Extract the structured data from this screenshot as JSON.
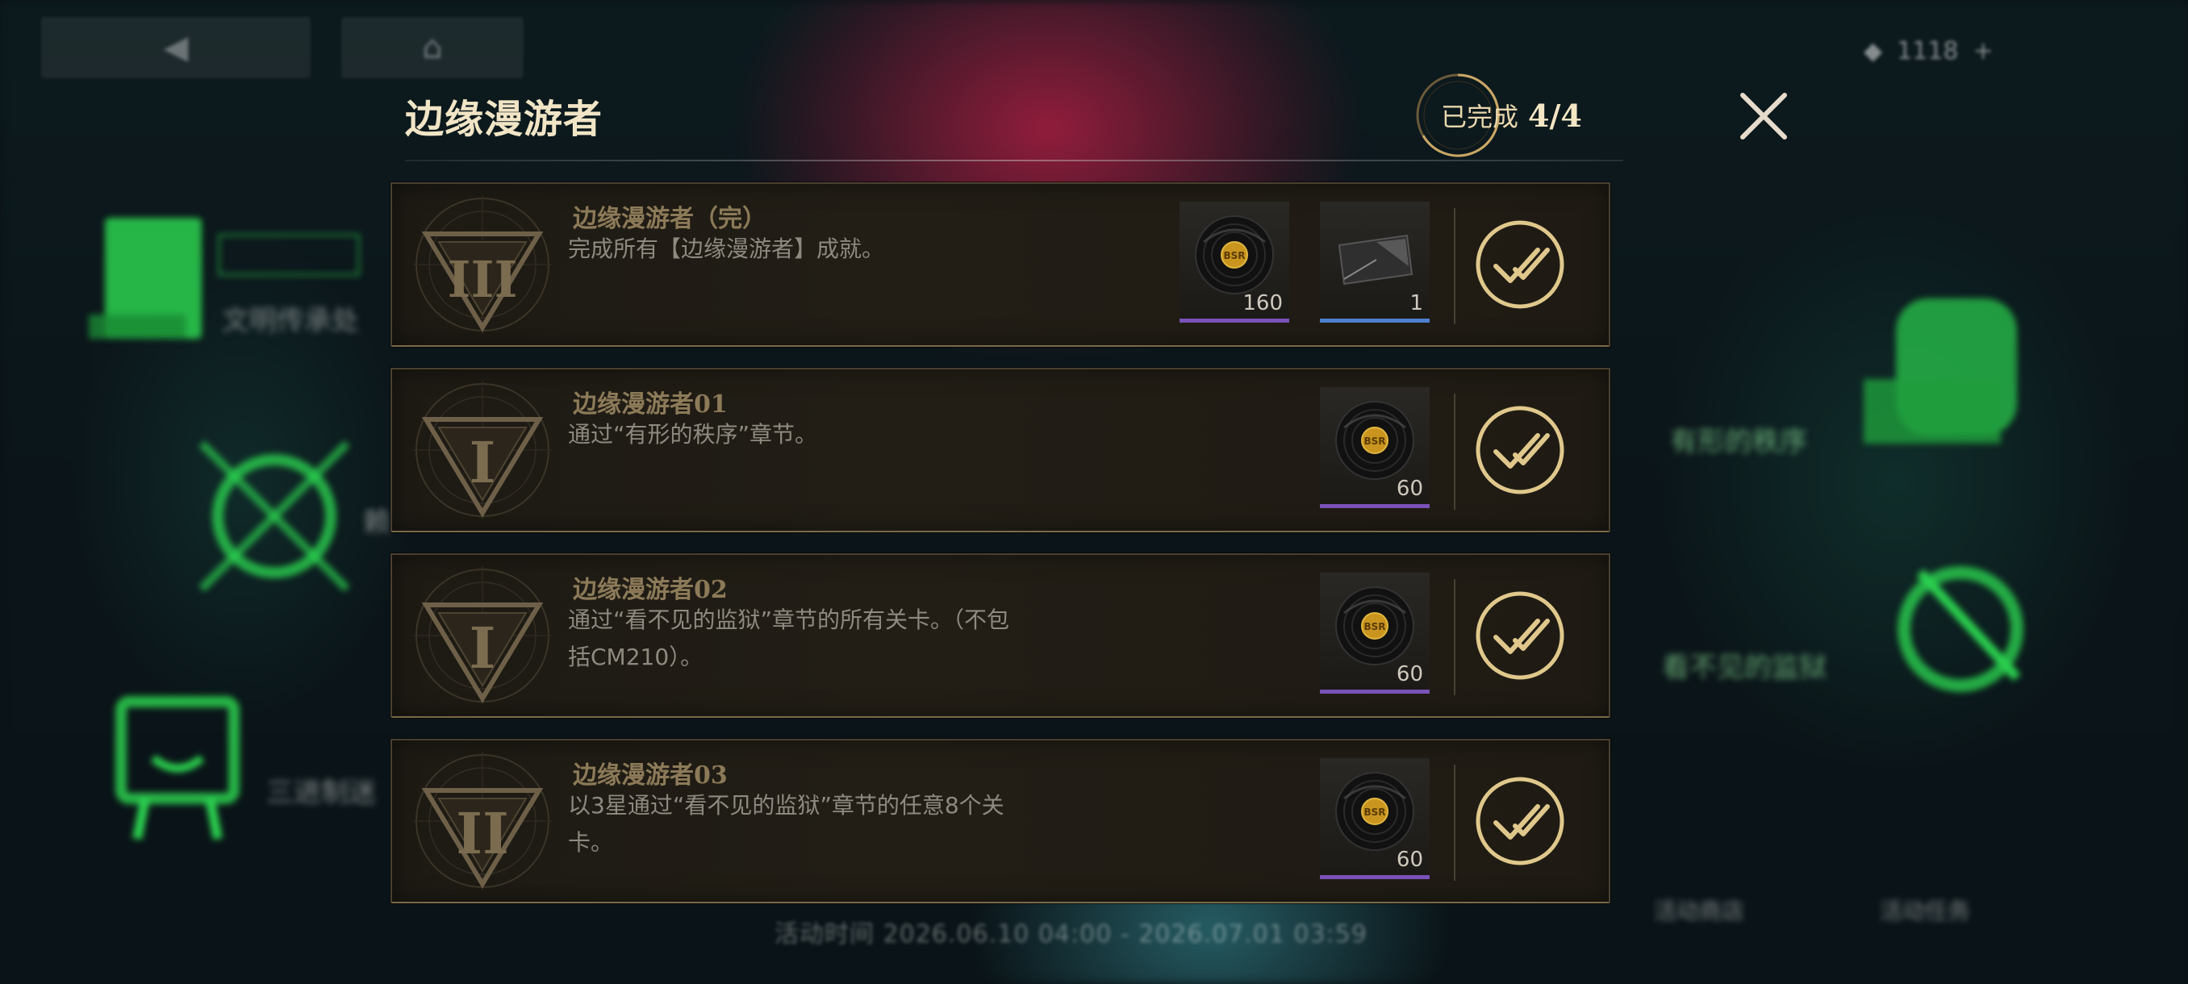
{
  "modal": {
    "title": "边缘漫游者",
    "progress_label": "已完成",
    "progress_value": "4/4"
  },
  "achievements": [
    {
      "title": "边缘漫游者（完）",
      "desc": "完成所有【边缘漫游者】成就。",
      "emblem": "III",
      "rewards": [
        {
          "icon": "record-disc-icon",
          "qty": "160",
          "rarity": "purple"
        },
        {
          "icon": "gray-card-icon",
          "qty": "1",
          "rarity": "blue"
        }
      ],
      "completed": true
    },
    {
      "title": "边缘漫游者01",
      "desc": "通过“有形的秩序”章节。",
      "emblem": "I",
      "rewards": [
        {
          "icon": "record-disc-icon",
          "qty": "60",
          "rarity": "purple"
        }
      ],
      "completed": true
    },
    {
      "title": "边缘漫游者02",
      "desc": "通过“看不见的监狱”章节的所有关卡。（不包括CM210）。",
      "emblem": "I",
      "rewards": [
        {
          "icon": "record-disc-icon",
          "qty": "60",
          "rarity": "purple"
        }
      ],
      "completed": true
    },
    {
      "title": "边缘漫游者03",
      "desc": "以3星通过“看不见的监狱”章节的任意8个关卡。",
      "emblem": "II",
      "rewards": [
        {
          "icon": "record-disc-icon",
          "qty": "60",
          "rarity": "purple"
        }
      ],
      "completed": true
    }
  ],
  "background": {
    "currency_value": "1118",
    "footer_time": "活动时间 2026.06.10 04:00 - 2026.07.01 03:59",
    "left_labels": [
      "文明传承处",
      "赖",
      "三进制迷"
    ],
    "right_labels": [
      "有形的秩序",
      "看不见的监狱"
    ],
    "bottom_right_labels": [
      "活动商店",
      "活动任务"
    ]
  },
  "colors": {
    "gold": "#e0c88c",
    "panel": "#1f1b14",
    "green": "#39ff6a"
  }
}
